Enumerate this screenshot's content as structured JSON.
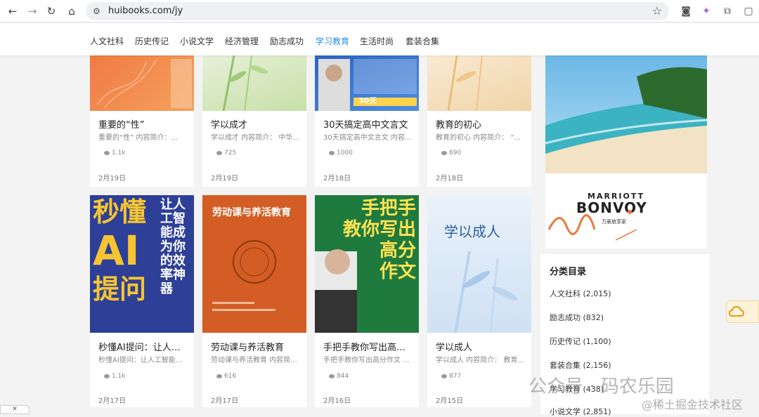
{
  "browser": {
    "url": "huibooks.com/jy",
    "back_icon": "←",
    "forward_icon": "→",
    "reload_icon": "↻",
    "home_icon": "⌂",
    "star_icon": "☆",
    "camera_icon": "◙",
    "extension_icon": "✦",
    "puzzle_icon": "⧉",
    "sidebar_icon": "▢"
  },
  "categories_nav": [
    "人文社科",
    "历史传记",
    "小说文学",
    "经济管理",
    "励志成功",
    "学习教育",
    "生活时尚",
    "套装合集"
  ],
  "active_category": "学习教育",
  "books_row1": [
    {
      "title": "重要的“性”",
      "desc": "重要的“性” 内容简介：...",
      "views": "1.1k",
      "date": "2月19日"
    },
    {
      "title": "学以成才",
      "desc": "学以成才 内容简介： 中华...",
      "views": "725",
      "date": "2月19日"
    },
    {
      "title": "30天搞定高中文言文",
      "desc": "30天搞定高中文言文 内容...",
      "views": "1000",
      "date": "2月18日"
    },
    {
      "title": "教育的初心",
      "desc": "教育的初心 内容简介： “...",
      "views": "690",
      "date": "2月18日"
    }
  ],
  "books_row2": [
    {
      "title": "秒懂AI提问：让人工...",
      "desc": "秒懂AI提问：让人工智能...",
      "views": "1.1k",
      "date": "2月17日"
    },
    {
      "title": "劳动课与养活教育",
      "desc": "劳动课与养活教育 内容简...",
      "views": "616",
      "date": "2月17日"
    },
    {
      "title": "手把手教你写出高分...",
      "desc": "手把手教你写出高分作文 ...",
      "views": "844",
      "date": "2月16日"
    },
    {
      "title": "学以成人",
      "desc": "学以成人 内容简介： 教育...",
      "views": "877",
      "date": "2月15日"
    }
  ],
  "covers": {
    "ai_cover": [
      "秒懂",
      "AI",
      "提问"
    ],
    "ai_side": "让人工智能成为你的效率神器",
    "labor_cover": "劳动课与养活教育",
    "writing_cover": [
      "手把手",
      "教你写出",
      "高分",
      "作文"
    ],
    "adult_cover": "学以成人",
    "first_row_cover": "30天"
  },
  "ad": {
    "brand_top": "MARRIOTT",
    "brand_main": "BONVOY",
    "brand_sub": "万豪旅享家"
  },
  "category_panel": {
    "heading": "分类目录",
    "items": [
      "人文社科 (2,015)",
      "励志成功 (832)",
      "历史传记 (1,100)",
      "套装合集 (2,156)",
      "学习教育 (438)",
      "小说文学 (2,851)"
    ]
  },
  "watermark": {
    "line1": "公众号 · 码农乐园",
    "line2": "@稀土掘金技术社区"
  },
  "corner_tab": "✕"
}
